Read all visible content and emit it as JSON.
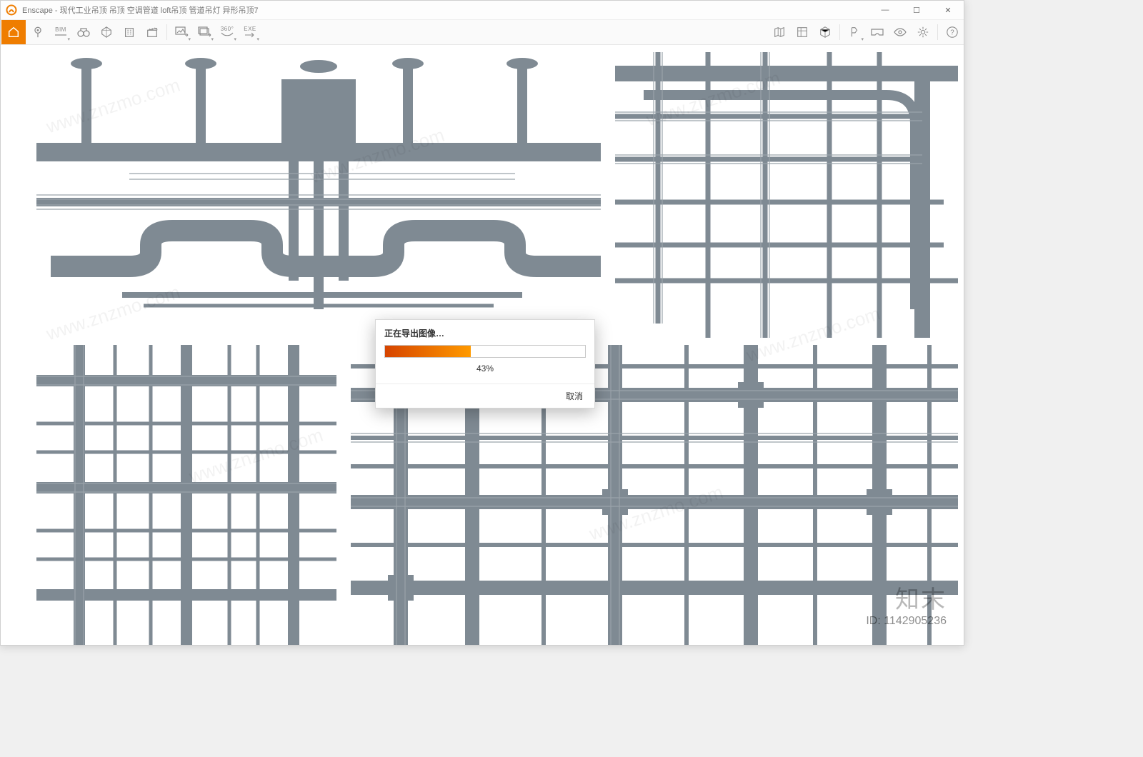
{
  "app": {
    "title": "Enscape - 现代工业吊顶 吊顶 空调管道 loft吊顶 管道吊灯 异形吊顶7"
  },
  "window_controls": {
    "min": "—",
    "max": "☐",
    "close": "✕"
  },
  "toolbar": {
    "home": "home",
    "left": [
      {
        "name": "favorite-view-button",
        "icon": "pin"
      },
      {
        "name": "bim-mode-button",
        "icon": "bim",
        "label": "BIM"
      },
      {
        "name": "walk-mode-button",
        "icon": "binoc"
      },
      {
        "name": "fly-mode-button",
        "icon": "prisma"
      },
      {
        "name": "map-view-button",
        "icon": "building"
      },
      {
        "name": "video-path-button",
        "icon": "clapper"
      }
    ],
    "export": [
      {
        "name": "screenshot-button",
        "icon": "img-export"
      },
      {
        "name": "batch-render-button",
        "icon": "img-batch"
      },
      {
        "name": "panorama-button",
        "icon": "pano",
        "label": "360°"
      },
      {
        "name": "exe-export-button",
        "icon": "exe",
        "label": "EXE"
      }
    ],
    "right": [
      {
        "name": "minimap-button",
        "icon": "map"
      },
      {
        "name": "asset-library-button",
        "icon": "assets"
      },
      {
        "name": "light-view-button",
        "icon": "box"
      },
      {
        "name": "sun-settings-button",
        "icon": "flag"
      },
      {
        "name": "vr-button",
        "icon": "vr"
      },
      {
        "name": "show-button",
        "icon": "eye"
      },
      {
        "name": "settings-button",
        "icon": "gear"
      }
    ],
    "help": {
      "name": "help-button",
      "label": "?"
    }
  },
  "dialog": {
    "title": "正在导出图像…",
    "percent": 43,
    "percent_label": "43%",
    "cancel": "取消"
  },
  "watermark": {
    "text": "www.znzmo.com",
    "brand": "知末",
    "id_label": "ID: 1142905236"
  }
}
